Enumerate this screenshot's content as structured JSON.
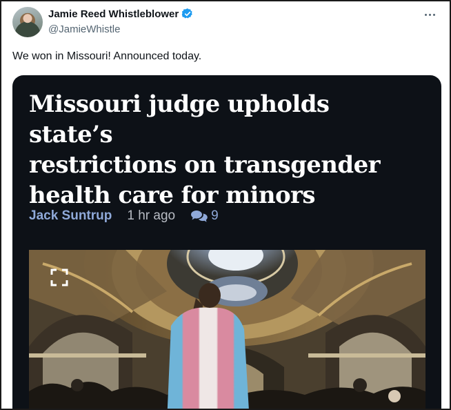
{
  "author": {
    "display_name": "Jamie Reed Whistleblower",
    "handle": "@JamieWhistle",
    "verified": true
  },
  "tweet": {
    "text": "We won in Missouri! Announced today."
  },
  "card": {
    "headline_lines": [
      "Missouri judge upholds state’s",
      "restrictions on transgender",
      "health care for minors"
    ],
    "byline": "Jack Suntrup",
    "time": "1 hr ago",
    "comment_count": "9"
  },
  "colors": {
    "verified": "#1d9bf0",
    "card_bg": "#0d1117",
    "byline": "#8fa9d9"
  },
  "icons": {
    "more": "more-horizontal-icon",
    "verified": "verified-badge-icon",
    "comment": "comment-bubbles-icon",
    "fullscreen": "expand-icon"
  }
}
